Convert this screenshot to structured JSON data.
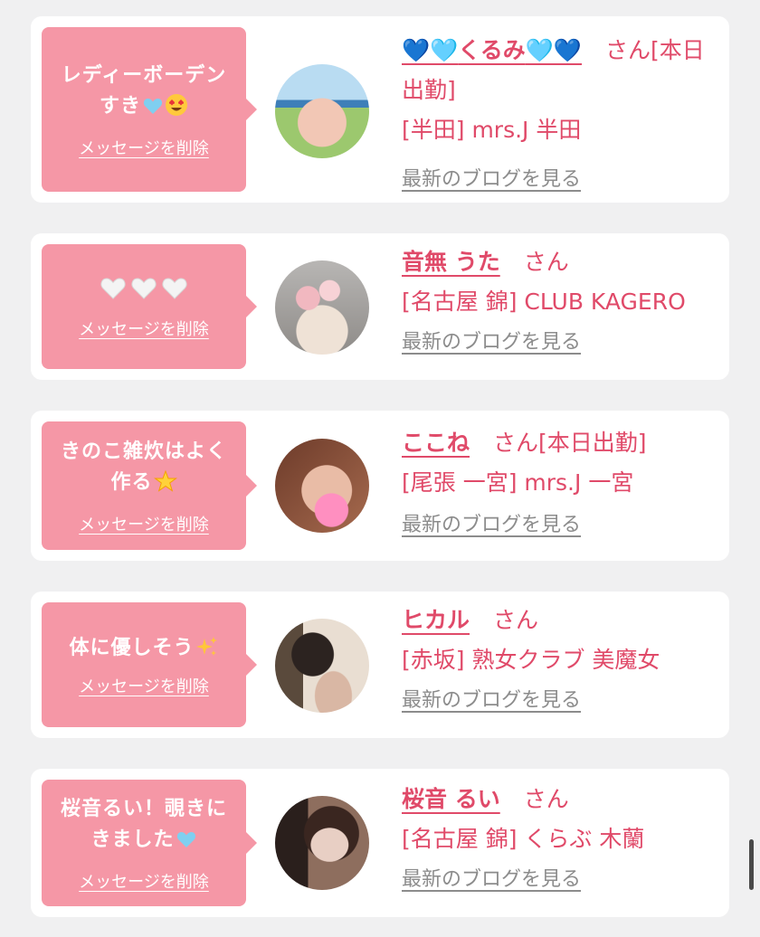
{
  "cards": [
    {
      "message": "レディーボーデンすき",
      "message_emoji": [
        "💙",
        "😍"
      ],
      "delete_label": "メッセージを削除",
      "name_prefix": "💙🩵",
      "name": "くるみ",
      "name_suffix": "🩵💙",
      "suffix": "さん[本日出勤]",
      "shop": "[半田] mrs.J 半田",
      "blog_label": "最新のブログを見る"
    },
    {
      "message": "🤍🤍🤍",
      "message_emoji": [],
      "delete_label": "メッセージを削除",
      "name": "音無 うた",
      "suffix": "さん",
      "shop": "[名古屋 錦] CLUB KAGERO",
      "blog_label": "最新のブログを見る"
    },
    {
      "message": "きのこ雑炊はよく作る",
      "message_emoji": [
        "🌟"
      ],
      "delete_label": "メッセージを削除",
      "name": "ここね",
      "suffix": "さん[本日出勤]",
      "shop": "[尾張 一宮] mrs.J 一宮",
      "blog_label": "最新のブログを見る"
    },
    {
      "message": "体に優しそう",
      "message_emoji": [
        "✨"
      ],
      "delete_label": "メッセージを削除",
      "name": "ヒカル",
      "suffix": "さん",
      "shop": "[赤坂] 熟女クラブ 美魔女",
      "blog_label": "最新のブログを見る"
    },
    {
      "message": "桜音るい！覗きにきました",
      "message_emoji": [
        "💙"
      ],
      "delete_label": "メッセージを削除",
      "name": "桜音 るい",
      "suffix": "さん",
      "shop": "[名古屋 錦] くらぶ 木蘭",
      "blog_label": "最新のブログを見る"
    }
  ],
  "colors": {
    "accent": "#e04a69",
    "bubble": "#f597a6",
    "link_gray": "#8c8c8c",
    "background": "#f0f0f1"
  }
}
